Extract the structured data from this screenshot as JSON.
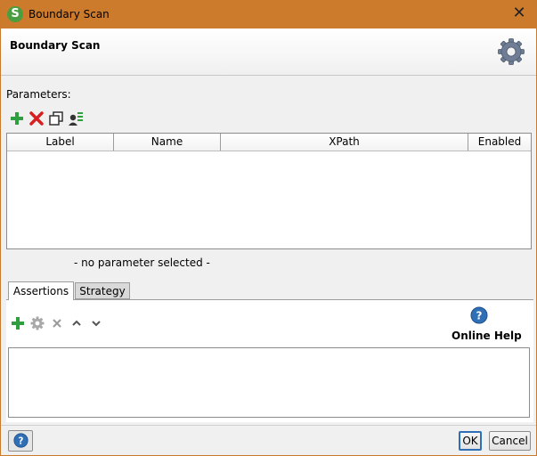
{
  "window": {
    "title": "Boundary Scan",
    "close_glyph": "✕",
    "app_icon_letter": "S"
  },
  "header": {
    "title": "Boundary Scan",
    "icon": "gear-icon"
  },
  "parameters": {
    "label": "Parameters:",
    "toolbar": [
      "add-icon",
      "delete-icon",
      "clone-icon",
      "assign-icon"
    ],
    "columns": [
      "Label",
      "Name",
      "XPath",
      "Enabled"
    ],
    "rows": [],
    "empty_message": "- no parameter selected -"
  },
  "tabs": [
    {
      "label": "Assertions",
      "active": true
    },
    {
      "label": "Strategy",
      "active": false
    }
  ],
  "assertions": {
    "toolbar": [
      "add-icon",
      "configure-icon",
      "remove-icon",
      "move-up-icon",
      "move-down-icon"
    ],
    "online_help_label": "Online Help"
  },
  "footer": {
    "ok_label": "OK",
    "cancel_label": "Cancel"
  },
  "colors": {
    "titlebar": "#cc7a2c",
    "add": "#2e9e3e",
    "delete": "#d62020",
    "help": "#2f6fb5"
  }
}
